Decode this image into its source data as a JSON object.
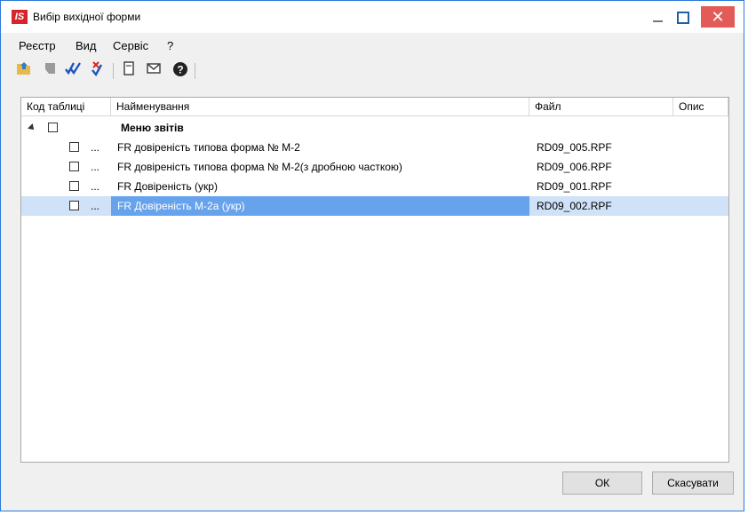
{
  "window": {
    "title": "Вибір вихідної форми",
    "logo_text": "IS",
    "close_glyph": "✕"
  },
  "menu": [
    "Реєстр",
    "Вид",
    "Сервіс",
    "?"
  ],
  "toolbar": {
    "icons": [
      "folder-up-icon",
      "inactive-flag-icon",
      "check-all-icon",
      "uncheck-all-icon",
      "document-icon",
      "envelope-icon",
      "help-icon"
    ]
  },
  "table": {
    "headers": {
      "code": "Код таблиці",
      "name": "Найменування",
      "file": "Файл",
      "desc": "Опис"
    },
    "group": {
      "label": "Меню звітів"
    },
    "rows": [
      {
        "dots": "...",
        "name": "FR довіреність типова форма № М-2",
        "file": "RD09_005.RPF",
        "desc": ""
      },
      {
        "dots": "...",
        "name": "FR довіреність типова форма № М-2(з дробною часткою)",
        "file": "RD09_006.RPF",
        "desc": ""
      },
      {
        "dots": "...",
        "name": "FR Довіреність (укр)",
        "file": "RD09_001.RPF",
        "desc": ""
      },
      {
        "dots": "...",
        "name": "FR Довіреність М-2а (укр)",
        "file": "RD09_002.RPF",
        "desc": ""
      }
    ]
  },
  "buttons": {
    "ok": "ОК",
    "cancel": "Скасувати"
  },
  "colors": {
    "accent": "#2b79d8",
    "selection": "#66a3ec",
    "close": "#e35b57"
  }
}
